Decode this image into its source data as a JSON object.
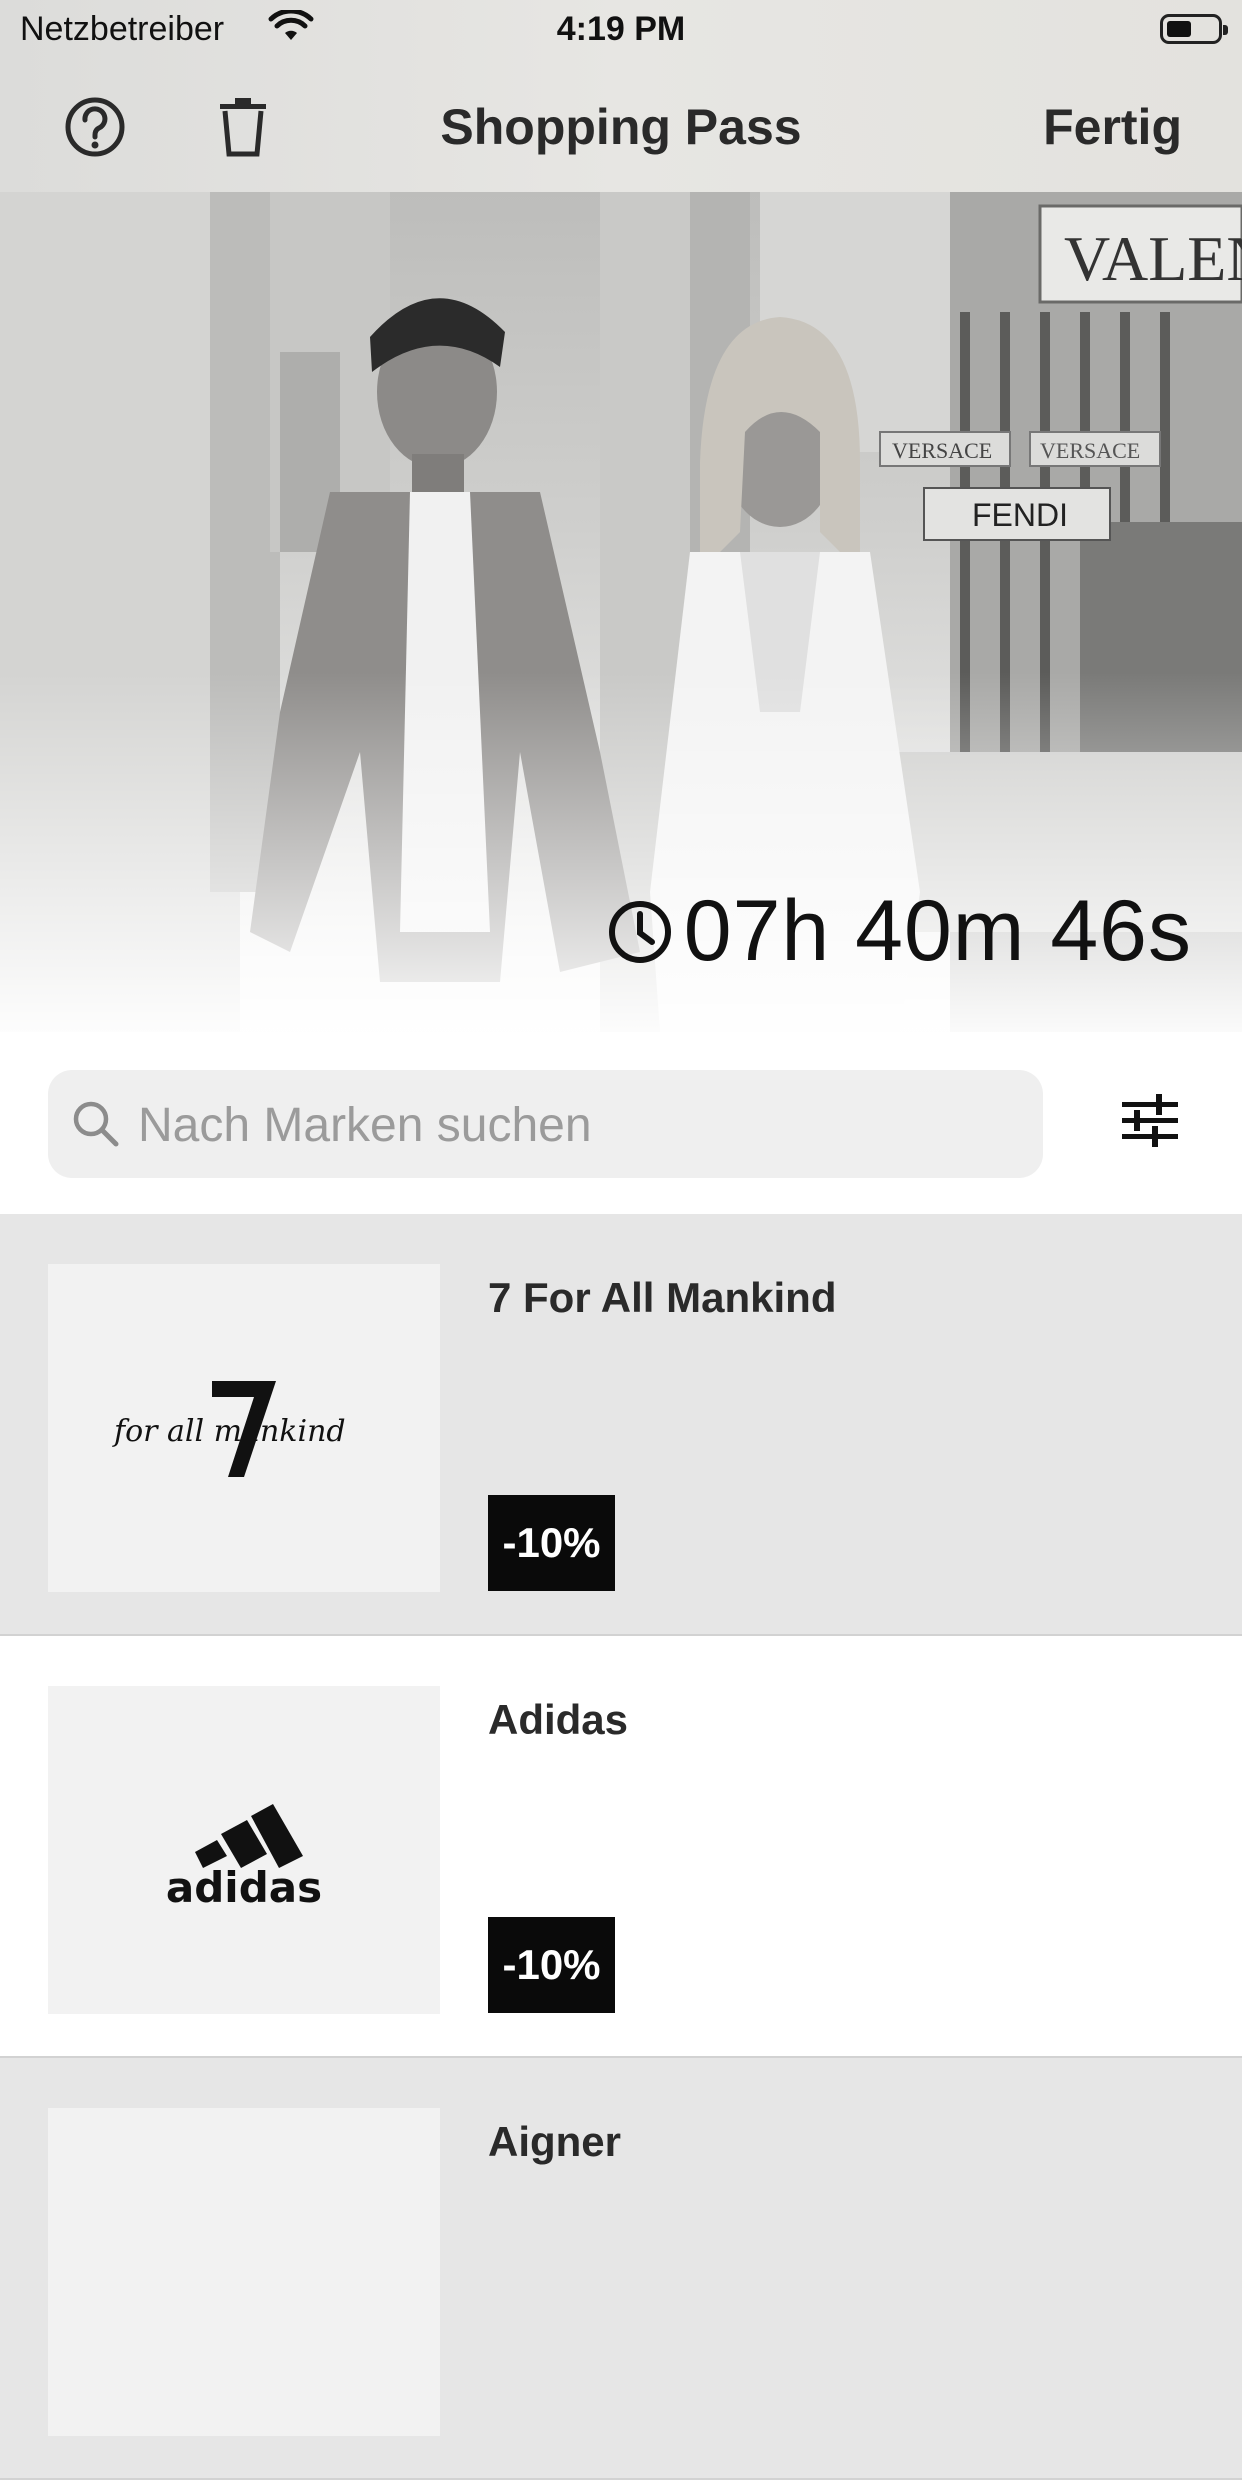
{
  "status_bar": {
    "carrier": "Netzbetreiber",
    "time": "4:19 PM",
    "icons": [
      "wifi-icon",
      "battery-icon"
    ]
  },
  "navbar": {
    "title": "Shopping Pass",
    "done_label": "Fertig",
    "icons": [
      "help-circle-icon",
      "trash-icon"
    ]
  },
  "hero": {
    "sign_valentino": "VALEN",
    "sign_versace": "VERSACE",
    "sign_versace_2": "VERSACE",
    "sign_fendi": "FENDI",
    "timer": "07h 40m 46s",
    "timer_icon": "clock-icon"
  },
  "search": {
    "placeholder": "Nach Marken suchen",
    "value": "",
    "icon": "search-icon",
    "filter_icon": "sliders-icon"
  },
  "brands": [
    {
      "name": "7 For All Mankind",
      "discount": "-10%",
      "logo_text": "for all mankind",
      "logo_numeral": "7"
    },
    {
      "name": "Adidas",
      "discount": "-10%",
      "logo_text": "adidas"
    },
    {
      "name": "Aigner",
      "discount": "",
      "logo_text": ""
    }
  ],
  "colors": {
    "badge_bg": "#0a0a0a",
    "row_shaded": "#e6e6e6",
    "logo_bg": "#f2f2f2",
    "search_bg": "#efefef"
  }
}
